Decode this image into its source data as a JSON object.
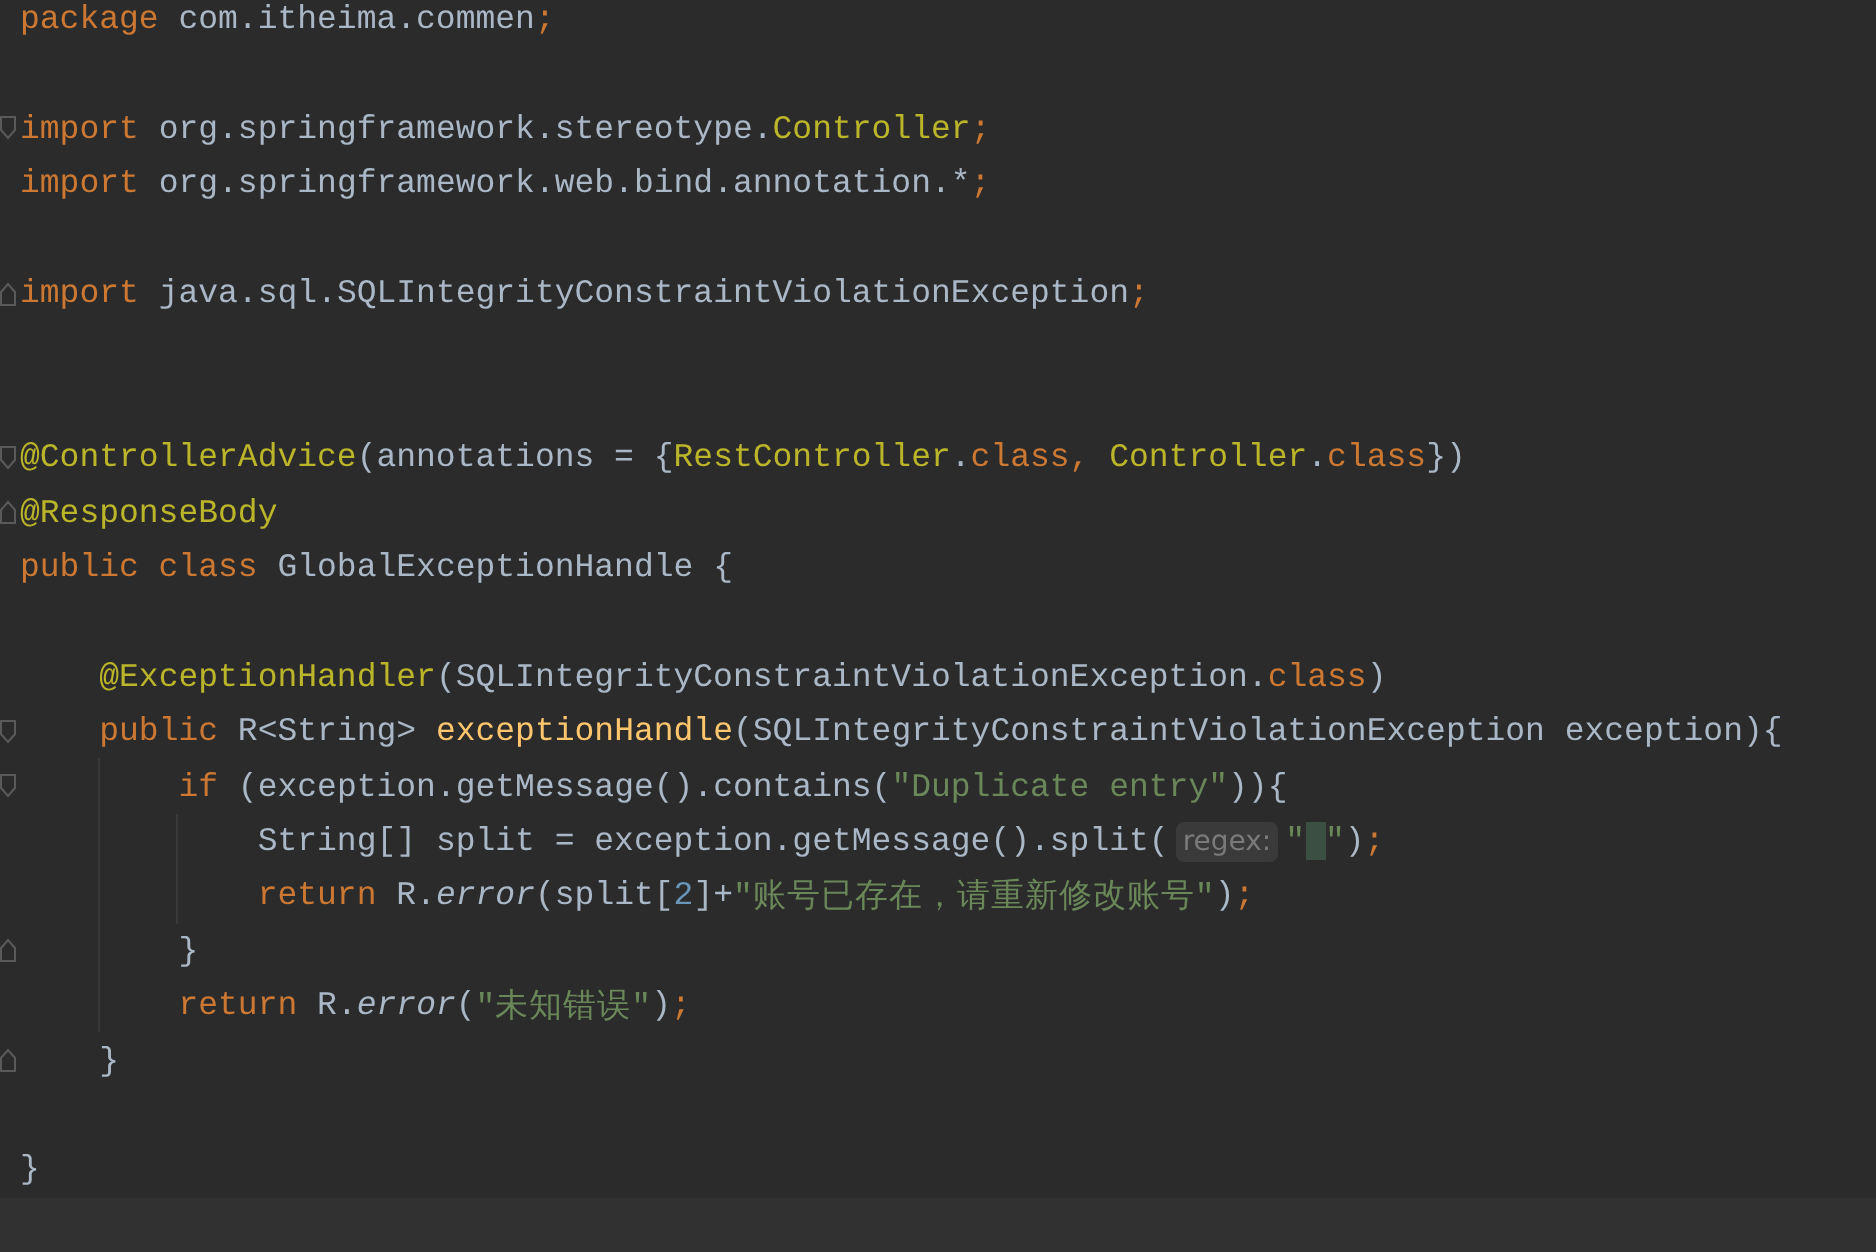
{
  "editor": {
    "lines": [
      {
        "kind": "code",
        "fold_start": false,
        "fold_end": false,
        "tokens": [
          {
            "kind": "kw",
            "text": "package"
          },
          {
            "kind": "plain",
            "text": " com.itheima.commen"
          },
          {
            "kind": "kw",
            "text": ";"
          }
        ]
      },
      {
        "kind": "blank"
      },
      {
        "kind": "code",
        "fold_start": true,
        "fold_end": false,
        "tokens": [
          {
            "kind": "kw",
            "text": "import"
          },
          {
            "kind": "plain",
            "text": " org.springframework.stereotype."
          },
          {
            "kind": "ann",
            "text": "Controller"
          },
          {
            "kind": "kw",
            "text": ";"
          }
        ]
      },
      {
        "kind": "code",
        "fold_start": false,
        "fold_end": false,
        "tokens": [
          {
            "kind": "kw",
            "text": "import"
          },
          {
            "kind": "plain",
            "text": " org.springframework.web.bind.annotation.*"
          },
          {
            "kind": "kw",
            "text": ";"
          }
        ]
      },
      {
        "kind": "blank"
      },
      {
        "kind": "code",
        "fold_start": false,
        "fold_end": true,
        "tokens": [
          {
            "kind": "kw",
            "text": "import"
          },
          {
            "kind": "plain",
            "text": " java.sql.SQLIntegrityConstraintViolationException"
          },
          {
            "kind": "kw",
            "text": ";"
          }
        ]
      },
      {
        "kind": "blank"
      },
      {
        "kind": "blank"
      },
      {
        "kind": "code",
        "fold_start": true,
        "fold_end": false,
        "tokens": [
          {
            "kind": "ann",
            "text": "@ControllerAdvice"
          },
          {
            "kind": "plain",
            "text": "(annotations = {"
          },
          {
            "kind": "ann",
            "text": "RestController"
          },
          {
            "kind": "plain",
            "text": "."
          },
          {
            "kind": "kw",
            "text": "class,"
          },
          {
            "kind": "ann",
            "text": " Controller"
          },
          {
            "kind": "plain",
            "text": "."
          },
          {
            "kind": "kw",
            "text": "class"
          },
          {
            "kind": "plain",
            "text": "})"
          }
        ]
      },
      {
        "kind": "code",
        "fold_start": false,
        "fold_end": true,
        "tokens": [
          {
            "kind": "ann",
            "text": "@ResponseBody"
          }
        ]
      },
      {
        "kind": "code",
        "fold_start": false,
        "fold_end": false,
        "tokens": [
          {
            "kind": "kw",
            "text": "public class"
          },
          {
            "kind": "plain",
            "text": " GlobalExceptionHandle {"
          }
        ]
      },
      {
        "kind": "blank"
      },
      {
        "kind": "code",
        "fold_start": false,
        "fold_end": false,
        "tokens": [
          {
            "kind": "ann",
            "text": "    @ExceptionHandler"
          },
          {
            "kind": "plain",
            "text": "(SQLIntegrityConstraintViolationException."
          },
          {
            "kind": "kw",
            "text": "class"
          },
          {
            "kind": "plain",
            "text": ")"
          }
        ]
      },
      {
        "kind": "code",
        "fold_start": true,
        "fold_end": false,
        "tokens": [
          {
            "kind": "kw",
            "text": "    public"
          },
          {
            "kind": "plain",
            "text": " R<String> "
          },
          {
            "kind": "method",
            "text": "exceptionHandle"
          },
          {
            "kind": "plain",
            "text": "(SQLIntegrityConstraintViolationException exception){"
          }
        ]
      },
      {
        "kind": "code",
        "fold_start": true,
        "fold_end": false,
        "tokens": [
          {
            "kind": "kw",
            "text": "        if"
          },
          {
            "kind": "plain",
            "text": " (exception.getMessage().contains("
          },
          {
            "kind": "str",
            "text": "\"Duplicate entry\""
          },
          {
            "kind": "plain",
            "text": ")){"
          }
        ]
      },
      {
        "kind": "code",
        "fold_start": false,
        "fold_end": false,
        "tokens": [
          {
            "kind": "plain",
            "text": "            String[] split = exception.getMessage().split("
          },
          {
            "kind": "hint",
            "text": "regex:"
          },
          {
            "kind": "caret-str",
            "text": "\" \""
          },
          {
            "kind": "plain",
            "text": ")"
          },
          {
            "kind": "kw",
            "text": ";"
          }
        ]
      },
      {
        "kind": "code",
        "fold_start": false,
        "fold_end": false,
        "tokens": [
          {
            "kind": "kw",
            "text": "            return"
          },
          {
            "kind": "plain",
            "text": " R."
          },
          {
            "kind": "static",
            "text": "error"
          },
          {
            "kind": "plain",
            "text": "(split["
          },
          {
            "kind": "num",
            "text": "2"
          },
          {
            "kind": "plain",
            "text": "]+"
          },
          {
            "kind": "str",
            "text": "\"账号已存在，请重新修改账号\""
          },
          {
            "kind": "plain",
            "text": ")"
          },
          {
            "kind": "kw",
            "text": ";"
          }
        ]
      },
      {
        "kind": "code",
        "fold_start": false,
        "fold_end": true,
        "tokens": [
          {
            "kind": "plain",
            "text": "        }"
          }
        ]
      },
      {
        "kind": "code",
        "fold_start": false,
        "fold_end": false,
        "tokens": [
          {
            "kind": "kw",
            "text": "        return"
          },
          {
            "kind": "plain",
            "text": " R."
          },
          {
            "kind": "static",
            "text": "error"
          },
          {
            "kind": "plain",
            "text": "("
          },
          {
            "kind": "str",
            "text": "\"未知错误\""
          },
          {
            "kind": "plain",
            "text": ")"
          },
          {
            "kind": "kw",
            "text": ";"
          }
        ]
      },
      {
        "kind": "code",
        "fold_start": false,
        "fold_end": true,
        "tokens": [
          {
            "kind": "plain",
            "text": "    }"
          }
        ]
      },
      {
        "kind": "blank"
      },
      {
        "kind": "code",
        "fold_start": false,
        "fold_end": false,
        "tokens": [
          {
            "kind": "plain",
            "text": "}"
          }
        ]
      }
    ]
  }
}
